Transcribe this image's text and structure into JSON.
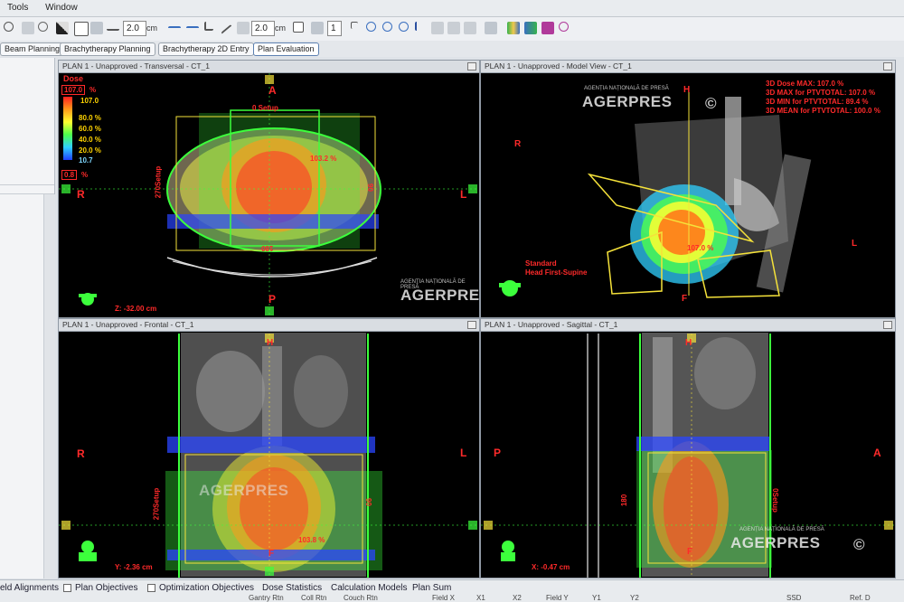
{
  "menu": {
    "tools": "Tools",
    "window": "Window"
  },
  "toolbar": {
    "zoom_value": "2.0",
    "zoom_unit": "cm",
    "width_value": "2.0",
    "width_unit": "cm",
    "count_value": "1"
  },
  "workspace_tabs": [
    "Beam Planning",
    "Brachytherapy Planning",
    "Brachytherapy 2D Entry",
    "Plan Evaluation"
  ],
  "viewports": {
    "transversal": {
      "title": "PLAN 1  -  Unapproved - Transversal - CT_1",
      "label_top": "A",
      "label_bottom": "P",
      "label_left": "R",
      "label_right": "L",
      "setup_label": "0 Setup",
      "angle_right": "90",
      "angle_left": "270Setup",
      "angle_bottom": "180",
      "dose_point": "103.2 %",
      "z_coord": "Z: -32.00 cm"
    },
    "model": {
      "title": "PLAN 1  -  Unapproved - Model View - CT_1",
      "label_h": "H",
      "label_f": "F",
      "label_r": "R",
      "label_l": "L",
      "orientation_line1": "Standard",
      "orientation_line2": "Head First-Supine",
      "dose_point": "107.0 %",
      "stats": [
        "3D Dose MAX: 107.0 %",
        "3D MAX for PTVTOTAL: 107.0 %",
        "3D MIN for PTVTOTAL: 89.4 %",
        "3D MEAN for PTVTOTAL: 100.0 %"
      ]
    },
    "frontal": {
      "title": "PLAN 1  -  Unapproved - Frontal - CT_1",
      "label_h": "H",
      "label_f": "F",
      "label_r": "R",
      "label_l": "L",
      "angle_left": "270Setup",
      "angle_right": "90",
      "dose_point": "103.8 %",
      "y_coord": "Y: -2.36 cm"
    },
    "sagittal": {
      "title": "PLAN 1  -  Unapproved - Sagittal - CT_1",
      "label_h": "H",
      "label_f": "F",
      "label_p": "P",
      "label_a": "A",
      "angle_left": "180",
      "angle_right": "0Setup",
      "x_coord": "X: -0.47 cm"
    }
  },
  "dose_legend": {
    "title": "Dose",
    "max_box": "107.0",
    "unit": "%",
    "max_value": "107.0",
    "levels": [
      "80.0 %",
      "60.0 %",
      "40.0 %",
      "20.0 %",
      "10.7"
    ],
    "min_box": "0.8",
    "min_unit": "%",
    "colors": [
      "#ff2020",
      "#ff9a1a",
      "#ffff30",
      "#4cff4c",
      "#30d0ff",
      "#2040ff"
    ]
  },
  "watermark": {
    "brand": "AGERPRES",
    "subtitle": "AGENȚIA NAȚIONALĂ DE PRESĂ",
    "symbol": "©"
  },
  "bottom_tabs": [
    "eld Alignments",
    "Plan Objectives",
    "Optimization Objectives",
    "Dose Statistics",
    "Calculation Models",
    "Plan Sum"
  ],
  "bottom_columns": [
    "Gantry Rtn",
    "Coll Rtn",
    "Couch Rtn",
    "Field X",
    "X1",
    "X2",
    "Field Y",
    "Y1",
    "Y2",
    "SSD",
    "Ref. D"
  ],
  "colors": {
    "dose_high": "#ff2a2a",
    "dose_mid": "#ffd400",
    "dose_low": "#3cff3c",
    "field_outline": "#f5e23a",
    "body_outline": "#3cff3c",
    "bolus_blue": "#2a45ff"
  }
}
